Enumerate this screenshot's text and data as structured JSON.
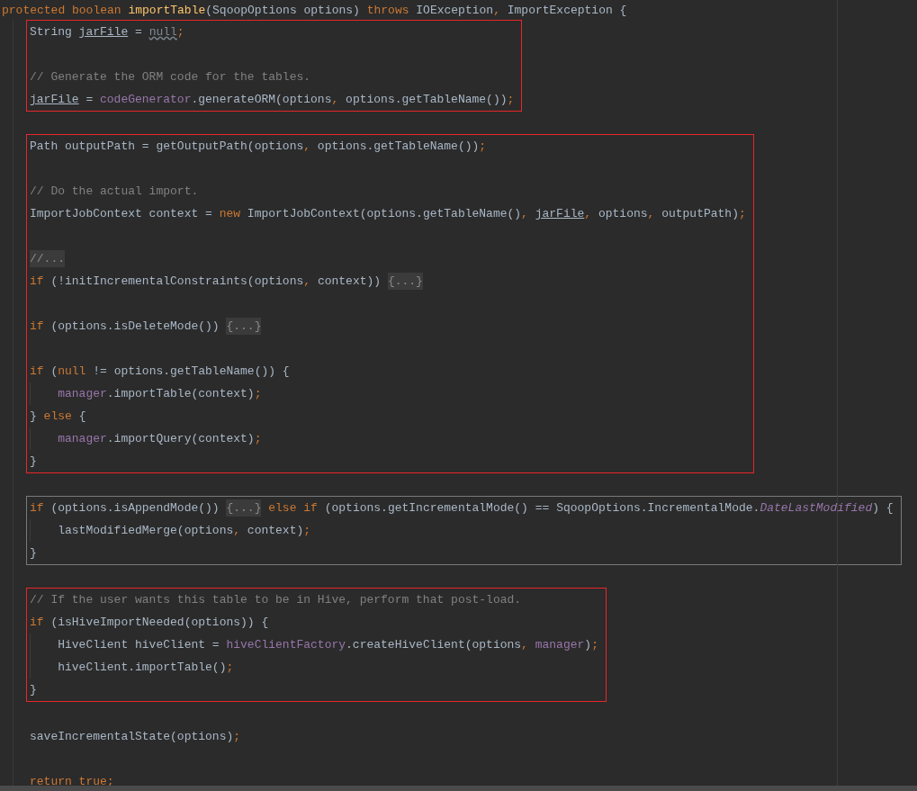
{
  "signature": [
    {
      "kind": "kw",
      "text": "protected boolean "
    },
    {
      "kind": "decl",
      "text": "importTable"
    },
    {
      "kind": "plain",
      "text": "(SqoopOptions options) "
    },
    {
      "kind": "kw",
      "text": "throws "
    },
    {
      "kind": "plain",
      "text": "IOException"
    },
    {
      "kind": "punct",
      "text": ", "
    },
    {
      "kind": "plain",
      "text": "ImportException {"
    }
  ],
  "sections": [
    {
      "framed": true,
      "color": "#e8262a",
      "paragraphs": [
        {
          "lines": [
            {
              "tokens": [
                {
                  "kind": "plain",
                  "text": "String "
                },
                {
                  "kind": "var",
                  "text": "jarFile"
                },
                {
                  "kind": "plain",
                  "text": " = "
                },
                {
                  "kind": "unused",
                  "text": "null"
                },
                {
                  "kind": "punct",
                  "text": ";"
                }
              ]
            }
          ]
        },
        {
          "lines": [
            {
              "tokens": [
                {
                  "kind": "comment",
                  "text": "// Generate the ORM code for the tables."
                }
              ]
            },
            {
              "tokens": [
                {
                  "kind": "var",
                  "text": "jarFile"
                },
                {
                  "kind": "plain",
                  "text": " = "
                },
                {
                  "kind": "field",
                  "text": "codeGenerator"
                },
                {
                  "kind": "plain",
                  "text": ".generateORM(options"
                },
                {
                  "kind": "punct",
                  "text": ", "
                },
                {
                  "kind": "plain",
                  "text": "options.getTableName())"
                },
                {
                  "kind": "punct",
                  "text": ";"
                }
              ]
            }
          ]
        }
      ]
    },
    {
      "framed": true,
      "color": "#e8262a",
      "paragraphs": [
        {
          "lines": [
            {
              "tokens": [
                {
                  "kind": "plain",
                  "text": "Path outputPath = getOutputPath(options"
                },
                {
                  "kind": "punct",
                  "text": ", "
                },
                {
                  "kind": "plain",
                  "text": "options.getTableName())"
                },
                {
                  "kind": "punct",
                  "text": ";"
                }
              ]
            }
          ]
        },
        {
          "lines": [
            {
              "tokens": [
                {
                  "kind": "comment",
                  "text": "// Do the actual import."
                }
              ]
            },
            {
              "tokens": [
                {
                  "kind": "plain",
                  "text": "ImportJobContext context = "
                },
                {
                  "kind": "kw",
                  "text": "new "
                },
                {
                  "kind": "plain",
                  "text": "ImportJobContext(options.getTableName()"
                },
                {
                  "kind": "punct",
                  "text": ", "
                },
                {
                  "kind": "var",
                  "text": "jarFile"
                },
                {
                  "kind": "punct",
                  "text": ", "
                },
                {
                  "kind": "plain",
                  "text": "options"
                },
                {
                  "kind": "punct",
                  "text": ", "
                },
                {
                  "kind": "plain",
                  "text": "outputPath)"
                },
                {
                  "kind": "punct",
                  "text": ";"
                }
              ]
            }
          ]
        },
        {
          "lines": [
            {
              "tokens": [
                {
                  "kind": "fold",
                  "text": "//..."
                }
              ]
            },
            {
              "tokens": [
                {
                  "kind": "kw",
                  "text": "if "
                },
                {
                  "kind": "plain",
                  "text": "(!initIncrementalConstraints(options"
                },
                {
                  "kind": "punct",
                  "text": ", "
                },
                {
                  "kind": "plain",
                  "text": "context)) "
                },
                {
                  "kind": "fold",
                  "text": "{...}"
                }
              ]
            }
          ]
        },
        {
          "lines": [
            {
              "tokens": [
                {
                  "kind": "kw",
                  "text": "if "
                },
                {
                  "kind": "plain",
                  "text": "(options.isDeleteMode()) "
                },
                {
                  "kind": "fold",
                  "text": "{...}"
                }
              ]
            }
          ]
        },
        {
          "lines": [
            {
              "tokens": [
                {
                  "kind": "kw",
                  "text": "if "
                },
                {
                  "kind": "plain",
                  "text": "("
                },
                {
                  "kind": "kw",
                  "text": "null "
                },
                {
                  "kind": "plain",
                  "text": "!= options.getTableName()) {"
                }
              ],
              "children": [
                {
                  "tokens": [
                    {
                      "kind": "field",
                      "text": "manager"
                    },
                    {
                      "kind": "plain",
                      "text": ".importTable(context)"
                    },
                    {
                      "kind": "punct",
                      "text": ";"
                    }
                  ]
                }
              ]
            },
            {
              "tokens": [
                {
                  "kind": "plain",
                  "text": "} "
                },
                {
                  "kind": "kw",
                  "text": "else "
                },
                {
                  "kind": "plain",
                  "text": "{"
                }
              ],
              "children": [
                {
                  "tokens": [
                    {
                      "kind": "field",
                      "text": "manager"
                    },
                    {
                      "kind": "plain",
                      "text": ".importQuery(context)"
                    },
                    {
                      "kind": "punct",
                      "text": ";"
                    }
                  ]
                }
              ]
            },
            {
              "tokens": [
                {
                  "kind": "plain",
                  "text": "}"
                }
              ]
            }
          ]
        }
      ]
    },
    {
      "framed": true,
      "color": "#7a7a7a",
      "paragraphs": [
        {
          "lines": [
            {
              "tokens": [
                {
                  "kind": "kw",
                  "text": "if "
                },
                {
                  "kind": "plain",
                  "text": "(options.isAppendMode()) "
                },
                {
                  "kind": "fold",
                  "text": "{...}"
                },
                {
                  "kind": "kw",
                  "text": " else if "
                },
                {
                  "kind": "plain",
                  "text": "(options.getIncrementalMode() == SqoopOptions.IncrementalMode."
                },
                {
                  "kind": "static",
                  "text": "DateLastModified"
                },
                {
                  "kind": "plain",
                  "text": ") {"
                }
              ],
              "children": [
                {
                  "tokens": [
                    {
                      "kind": "plain",
                      "text": "lastModifiedMerge(options"
                    },
                    {
                      "kind": "punct",
                      "text": ", "
                    },
                    {
                      "kind": "plain",
                      "text": "context)"
                    },
                    {
                      "kind": "punct",
                      "text": ";"
                    }
                  ]
                }
              ]
            },
            {
              "tokens": [
                {
                  "kind": "plain",
                  "text": "}"
                }
              ]
            }
          ]
        }
      ]
    },
    {
      "framed": true,
      "color": "#e8262a",
      "paragraphs": [
        {
          "lines": [
            {
              "tokens": [
                {
                  "kind": "comment",
                  "text": "// If the user wants this table to be in Hive, perform that post-load."
                }
              ]
            },
            {
              "tokens": [
                {
                  "kind": "kw",
                  "text": "if "
                },
                {
                  "kind": "plain",
                  "text": "(isHiveImportNeeded(options)) {"
                }
              ],
              "children": [
                {
                  "tokens": [
                    {
                      "kind": "plain",
                      "text": "HiveClient hiveClient = "
                    },
                    {
                      "kind": "field",
                      "text": "hiveClientFactory"
                    },
                    {
                      "kind": "plain",
                      "text": ".createHiveClient(options"
                    },
                    {
                      "kind": "punct",
                      "text": ", "
                    },
                    {
                      "kind": "field",
                      "text": "manager"
                    },
                    {
                      "kind": "plain",
                      "text": ")"
                    },
                    {
                      "kind": "punct",
                      "text": ";"
                    }
                  ]
                },
                {
                  "tokens": [
                    {
                      "kind": "plain",
                      "text": "hiveClient.importTable()"
                    },
                    {
                      "kind": "punct",
                      "text": ";"
                    }
                  ]
                }
              ]
            },
            {
              "tokens": [
                {
                  "kind": "plain",
                  "text": "}"
                }
              ]
            }
          ]
        }
      ]
    },
    {
      "framed": false,
      "paragraphs": [
        {
          "lines": [
            {
              "tokens": [
                {
                  "kind": "plain",
                  "text": "saveIncrementalState(options)"
                },
                {
                  "kind": "punct",
                  "text": ";"
                }
              ]
            }
          ]
        },
        {
          "lines": [
            {
              "tokens": [
                {
                  "kind": "kw",
                  "text": "return true"
                },
                {
                  "kind": "punct",
                  "text": ";"
                }
              ]
            }
          ]
        }
      ]
    }
  ]
}
